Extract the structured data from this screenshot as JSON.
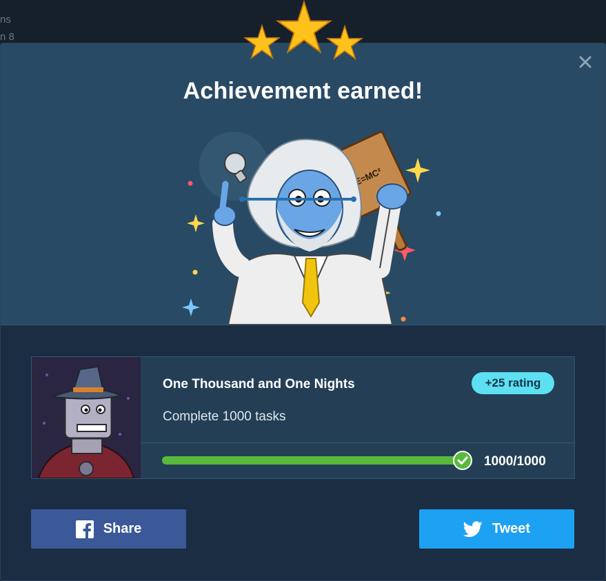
{
  "background": {
    "fragment_1": "ns",
    "fragment_2": "n 8"
  },
  "modal": {
    "title": "Achievement earned!",
    "close_icon": "close-icon",
    "star_count": 3
  },
  "achievement": {
    "name": "One Thousand and One Nights",
    "description": "Complete 1000 tasks",
    "reward": "+25 rating",
    "progress_current": 1000,
    "progress_total": 1000,
    "progress_label": "1000/1000",
    "formula_text": "E=MC²"
  },
  "share": {
    "facebook_label": "Share",
    "twitter_label": "Tweet",
    "facebook_icon": "facebook-icon",
    "twitter_icon": "twitter-icon"
  },
  "colors": {
    "modal_bg": "#1a2d42",
    "hero_bg": "#294a64",
    "badge": "#5de0f2",
    "progress": "#58b93c",
    "facebook": "#3b5998",
    "twitter": "#1da1f2"
  }
}
